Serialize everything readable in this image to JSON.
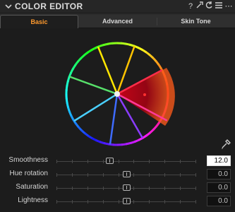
{
  "header": {
    "title": "COLOR EDITOR",
    "icons": [
      "help-icon",
      "auto-adjust-icon",
      "reset-icon",
      "menu-icon",
      "more-icon"
    ],
    "help_glyph": "?",
    "more_glyph": "⋯"
  },
  "tabs": [
    {
      "label": "Basic",
      "active": true
    },
    {
      "label": "Advanced",
      "active": false
    },
    {
      "label": "Skin Tone",
      "active": false
    }
  ],
  "colors": {
    "accent": "#ff9a2e",
    "selection": "#c0001a"
  },
  "wheel": {
    "selected_hue": "red",
    "spoke_colors": [
      "#ff2d4a",
      "#ffc300",
      "#ffe600",
      "#57e06a",
      "#4ad0ff",
      "#3e6bff",
      "#8a3cff",
      "#ff3a9a"
    ]
  },
  "sliders": [
    {
      "label": "Smoothness",
      "value": "12.0",
      "level": 0.38,
      "focused": true
    },
    {
      "label": "Hue rotation",
      "value": "0.0",
      "level": 0.5,
      "focused": false
    },
    {
      "label": "Saturation",
      "value": "0.0",
      "level": 0.5,
      "focused": false
    },
    {
      "label": "Lightness",
      "value": "0.0",
      "level": 0.5,
      "focused": false
    }
  ]
}
